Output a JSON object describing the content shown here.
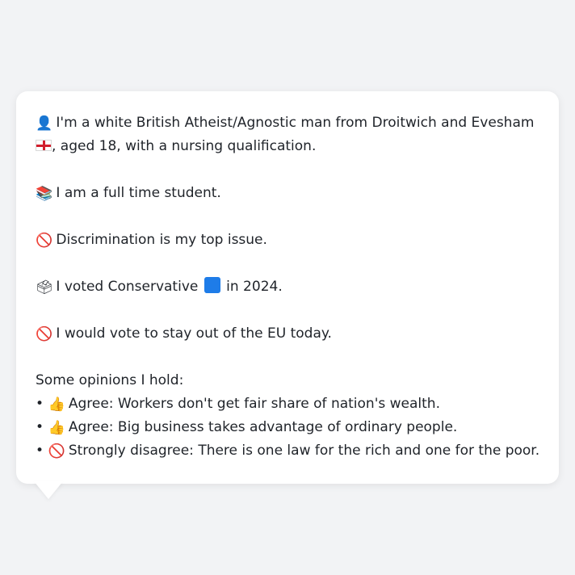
{
  "profile": {
    "identity": {
      "icon": "bust-silhouette-icon",
      "text_before": "I'm a white British Atheist/Agnostic man from Droitwich and Evesham",
      "flag_icon": "england-flag-icon",
      "text_after": ", aged 18, with a nursing qualification."
    },
    "occupation": {
      "icon": "books-icon",
      "text": "I am a full time student."
    },
    "top_issue": {
      "icon": "no-entry-icon",
      "text": "Discrimination is my top issue."
    },
    "vote": {
      "icon": "ballot-box-icon",
      "text_before": "I voted Conservative",
      "party_color_icon": "blue-square-icon",
      "text_after": "in 2024."
    },
    "eu": {
      "icon": "no-entry-icon",
      "text": "I would vote to stay out of the EU today."
    },
    "opinions": {
      "heading": "Some opinions I hold:",
      "items": [
        {
          "bullet": "•",
          "icon": "thumbs-up-icon",
          "text": "Agree: Workers don't get fair share of nation's wealth."
        },
        {
          "bullet": "•",
          "icon": "thumbs-up-icon",
          "text": "Agree: Big business takes advantage of ordinary people."
        },
        {
          "bullet": "•",
          "icon": "no-entry-icon",
          "text": "Strongly disagree: There is one law for the rich and one for the poor."
        }
      ]
    }
  },
  "colors": {
    "background": "#f2f3f5",
    "bubble": "#ffffff",
    "text": "#1f2329",
    "conservative_blue": "#1e7ce8"
  }
}
